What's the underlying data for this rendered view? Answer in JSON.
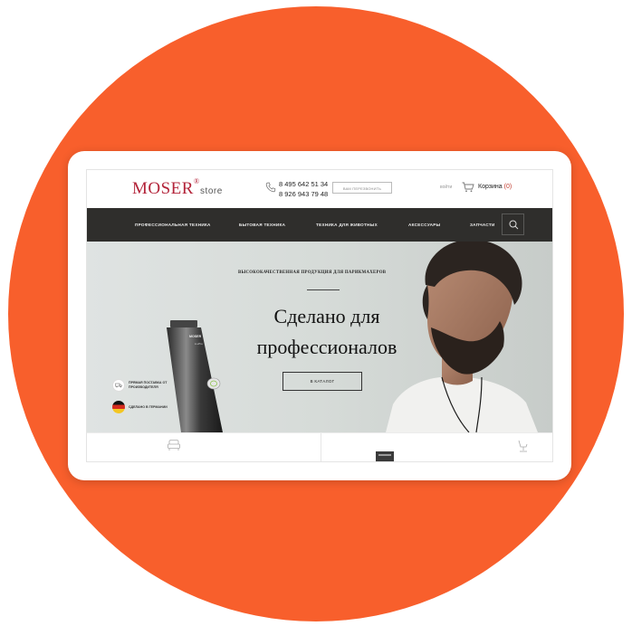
{
  "header": {
    "logo_main": "MOSER",
    "logo_reg": "®",
    "logo_sub": "store",
    "phone_1": "8 495 642 51 34",
    "phone_2": "8 926 943 79 48",
    "callback_label": "вам перезвонить",
    "login_label": "войти",
    "cart_label": "Корзина",
    "cart_count": "(0)"
  },
  "nav": {
    "items": [
      {
        "label": "Профессиональная техника"
      },
      {
        "label": "Бытовая техника"
      },
      {
        "label": "Техника для животных"
      },
      {
        "label": "Аксессуары"
      },
      {
        "label": "Запчасти"
      }
    ]
  },
  "hero": {
    "kicker": "Высококачественная продукция для парикмахеров",
    "title": "Сделано для\nпрофессионалов",
    "button_label": "В каталог",
    "badges": [
      {
        "text": "Прямая поставка от производителя",
        "icon": "truck-icon"
      },
      {
        "text": "Сделано в Германии",
        "icon": "germany-flag-icon"
      }
    ],
    "product_brand": "MOSER",
    "product_model": "Li+Pro"
  },
  "colors": {
    "accent": "#f85f2c",
    "brand": "#b3243a",
    "nav_bg": "#2f2e2c"
  }
}
